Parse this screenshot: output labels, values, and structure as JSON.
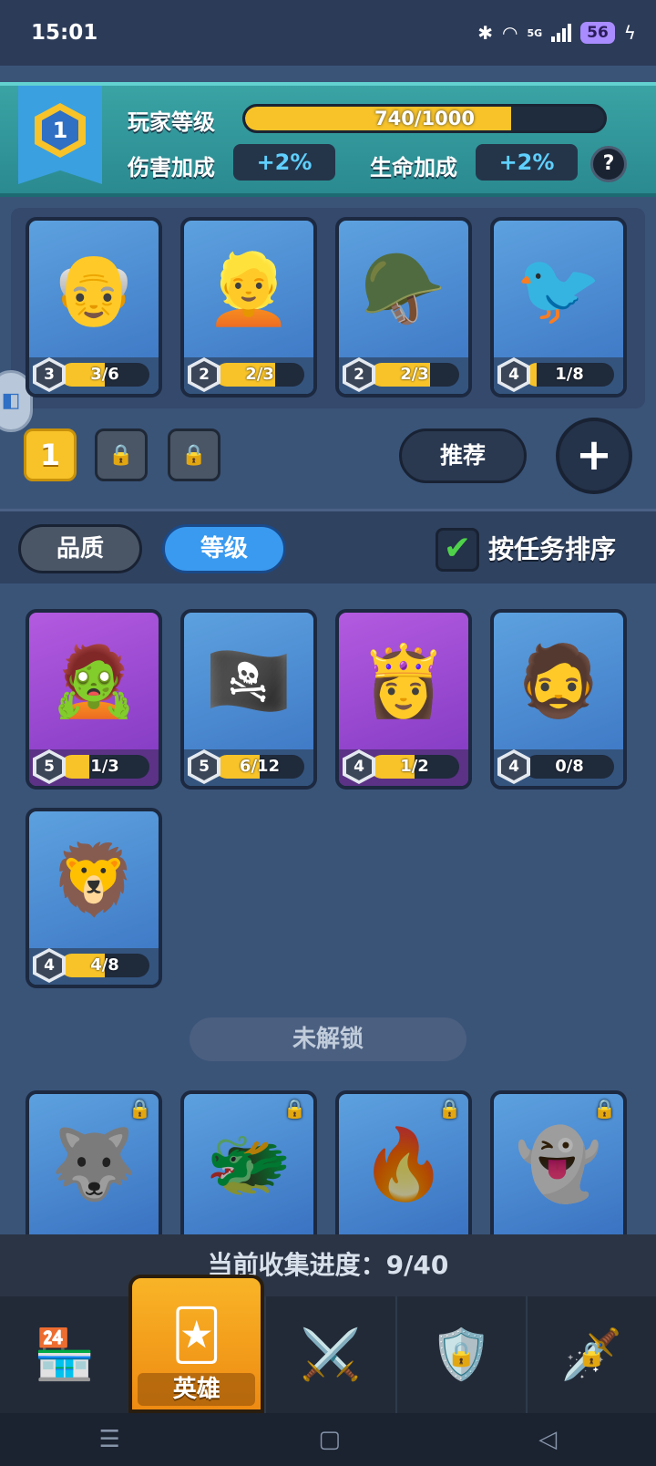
{
  "status_bar": {
    "time": "15:01",
    "network": "5G",
    "battery": "56"
  },
  "player": {
    "level": "1",
    "level_label": "玩家等级",
    "xp_text": "740/1000",
    "xp_progress": 0.74,
    "damage_label": "伤害加成",
    "damage_value": "+2%",
    "life_label": "生命加成",
    "life_value": "+2%",
    "help": "?"
  },
  "team": {
    "cards": [
      {
        "art": "👴",
        "level": "3",
        "progress_text": "3/6",
        "progress": 0.5,
        "color": "blue"
      },
      {
        "art": "👱",
        "level": "2",
        "progress_text": "2/3",
        "progress": 0.67,
        "color": "blue"
      },
      {
        "art": "🪖",
        "level": "2",
        "progress_text": "2/3",
        "progress": 0.67,
        "color": "blue"
      },
      {
        "art": "🐦",
        "level": "4",
        "progress_text": "1/8",
        "progress": 0.125,
        "color": "blue"
      }
    ],
    "slots": [
      "1",
      "🔒",
      "🔒"
    ],
    "recommend_label": "推荐",
    "add_label": "+"
  },
  "filters": {
    "quality_label": "品质",
    "level_label": "等级",
    "sort_check": "✔",
    "sort_label": "按任务排序"
  },
  "collection": [
    {
      "art": "🧟",
      "level": "5",
      "progress_text": "1/3",
      "progress": 0.33,
      "color": "purple"
    },
    {
      "art": "🏴‍☠️",
      "level": "5",
      "progress_text": "6/12",
      "progress": 0.5,
      "color": "blue"
    },
    {
      "art": "👸",
      "level": "4",
      "progress_text": "1/2",
      "progress": 0.5,
      "color": "purple"
    },
    {
      "art": "🧔",
      "level": "4",
      "progress_text": "0/8",
      "progress": 0.0,
      "color": "blue"
    },
    {
      "art": "🦁",
      "level": "4",
      "progress_text": "4/8",
      "progress": 0.5,
      "color": "blue"
    }
  ],
  "locked_section": {
    "title": "未解锁",
    "cards": [
      {
        "art": "🐺",
        "lock": "🔒"
      },
      {
        "art": "🐲",
        "lock": "🔒"
      },
      {
        "art": "🔥",
        "lock": "🔒"
      },
      {
        "art": "👻",
        "lock": "🔒"
      }
    ]
  },
  "collection_progress": "当前收集进度：9/40",
  "nav": {
    "shop_icon": "🏪",
    "heroes_icon": "🃏",
    "heroes_label": "英雄",
    "battle_icon": "⚔️",
    "guild_icon": "🛡️",
    "events_icon": "🗡️",
    "lock": "🔒"
  },
  "system_nav": {
    "menu": "☰",
    "home": "▢",
    "back": "◁"
  }
}
